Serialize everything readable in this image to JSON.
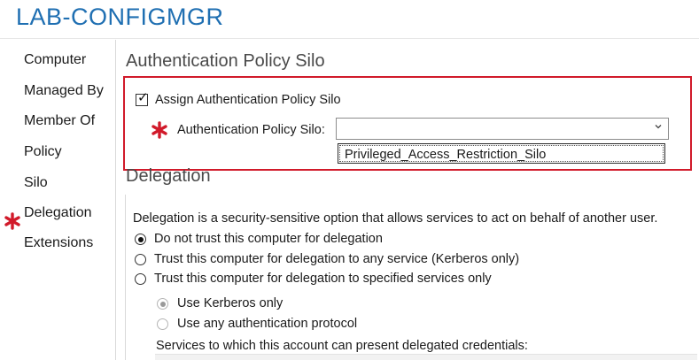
{
  "window": {
    "title": "LAB-CONFIGMGR"
  },
  "sidebar": {
    "items": [
      {
        "label": "Computer"
      },
      {
        "label": "Managed By"
      },
      {
        "label": "Member Of"
      },
      {
        "label": "Policy"
      },
      {
        "label": "Silo",
        "required": true
      },
      {
        "label": "Delegation"
      },
      {
        "label": "Extensions"
      }
    ],
    "required_marker_color": "#d11a2a"
  },
  "silo_section": {
    "title": "Authentication Policy Silo",
    "assign_checkbox": {
      "label": "Assign Authentication Policy Silo",
      "checked": true
    },
    "silo_field": {
      "label": "Authentication Policy Silo:",
      "value": "",
      "required": true
    },
    "dropdown_options": [
      "Privileged_Access_Restriction_Silo"
    ],
    "highlight_color": "#d11a2a"
  },
  "delegation_section": {
    "title": "Delegation",
    "description": "Delegation is a security-sensitive option that allows services to act on behalf of another user.",
    "options": [
      {
        "label": "Do not trust this computer for delegation",
        "selected": true
      },
      {
        "label": "Trust this computer for delegation to any service (Kerberos only)",
        "selected": false
      },
      {
        "label": "Trust this computer for delegation to specified services only",
        "selected": false
      }
    ],
    "sub_options": [
      {
        "label": "Use Kerberos only",
        "selected": true,
        "enabled": false
      },
      {
        "label": "Use any authentication protocol",
        "selected": false,
        "enabled": false
      }
    ],
    "services_label": "Services to which this account can present delegated credentials:"
  },
  "colors": {
    "accent": "#1f6fb2",
    "required": "#d11a2a"
  }
}
